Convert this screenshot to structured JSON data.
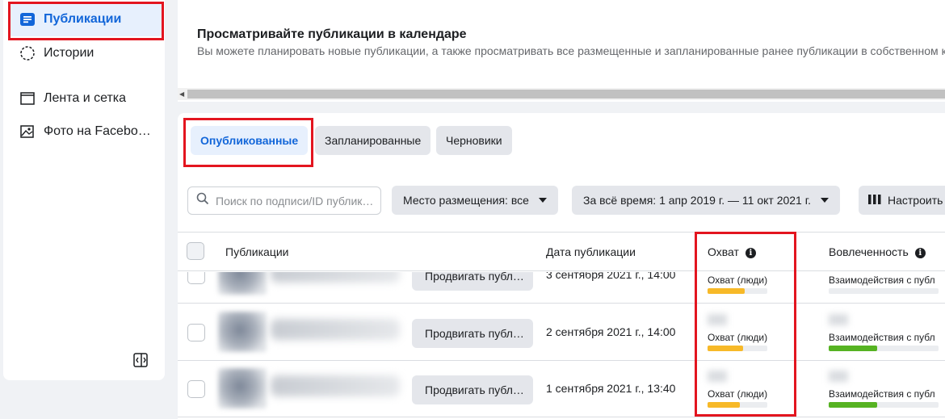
{
  "sidebar": {
    "items": [
      {
        "label": "Публикации",
        "icon": "posts-icon",
        "active": true
      },
      {
        "label": "Истории",
        "icon": "stories-icon",
        "active": false
      },
      {
        "label": "Лента и сетка",
        "icon": "feed-grid-icon",
        "active": false
      },
      {
        "label": "Фото на Facebo…",
        "icon": "facebook-photo-icon",
        "active": false
      }
    ]
  },
  "header": {
    "title": "Просматривайте публикации в календаре",
    "subtitle": "Вы можете планировать новые публикации, а также просматривать все размещенные и запланированные ранее публикации в собственном кал"
  },
  "tabs": [
    {
      "label": "Опубликованные",
      "active": true
    },
    {
      "label": "Запланированные",
      "active": false
    },
    {
      "label": "Черновики",
      "active": false
    }
  ],
  "filters": {
    "search_placeholder": "Поиск по подписи/ID публик…",
    "placement": "Место размещения: все",
    "period": "За всё время: 1 апр 2019 г. — 11 окт 2021 г.",
    "customize": "Настроить"
  },
  "table": {
    "columns": [
      "Публикации",
      "Дата публикации",
      "Охват",
      "Вовлеченность"
    ],
    "rows": [
      {
        "promote": "Продвигать публ…",
        "date": "3 сентября 2021 г., 14:00",
        "reach_label": "Охват (люди)",
        "reach_fraction": 0.62,
        "engagement_label": "Взаимодействия с публ",
        "engagement_fraction": 0.0
      },
      {
        "promote": "Продвигать публ…",
        "date": "2 сентября 2021 г., 14:00",
        "reach_label": "Охват (люди)",
        "reach_fraction": 0.59,
        "engagement_label": "Взаимодействия с публ",
        "engagement_fraction": 0.44
      },
      {
        "promote": "Продвигать публ…",
        "date": "1 сентября 2021 г., 13:40",
        "reach_label": "Охват (люди)",
        "reach_fraction": 0.54,
        "engagement_label": "Взаимодействия с публ",
        "engagement_fraction": 0.44
      }
    ]
  },
  "colors": {
    "accent": "#1266d9",
    "highlight": "#e3151f",
    "reach_bar": "#f7b928",
    "engagement_bar": "#56b322"
  }
}
